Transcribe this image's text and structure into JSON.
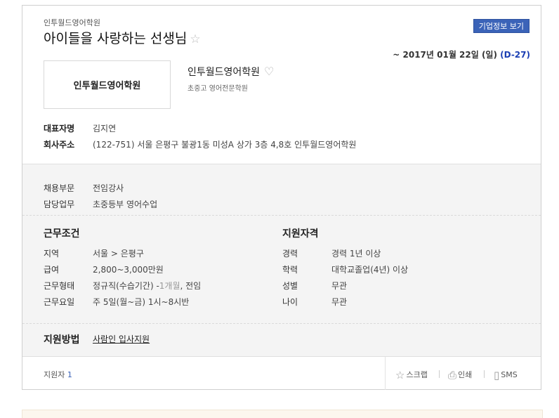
{
  "job": {
    "company_small": "인투월드영어학원",
    "title": "아이들을 사랑하는 선생님",
    "company_info_button": "기업정보 보기",
    "deadline_text": "~ 2017년 01월 22일 (일)",
    "dday": "(D-27)"
  },
  "company": {
    "logo_text": "인투월드영어학원",
    "name": "인투월드영어학원",
    "description": "초중고 영어전문학원",
    "ceo_label": "대표자명",
    "ceo": "김지연",
    "address_label": "회사주소",
    "address": "(122-751) 서울 은평구 불광1동 미성A 상가 3층 4,8호 인투월드영어학원"
  },
  "recruit": {
    "dept_label": "채용부문",
    "dept": "전임강사",
    "duty_label": "담당업무",
    "duty": "초중등부 영어수업"
  },
  "conditions": {
    "title": "근무조건",
    "region_label": "지역",
    "region": "서울 > 은평구",
    "salary_label": "급여",
    "salary": "2,800~3,000만원",
    "type_label": "근무형태",
    "type_main": "정규직(수습기간) -",
    "type_faded": "1개월",
    "type_tail": ", 전임",
    "days_label": "근무요일",
    "days": "주 5일(월~금) 1시~8시반"
  },
  "qualifications": {
    "title": "지원자격",
    "career_label": "경력",
    "career": "경력 1년 이상",
    "education_label": "학력",
    "education": "대학교졸업(4년) 이상",
    "gender_label": "성별",
    "gender": "무관",
    "age_label": "나이",
    "age": "무관"
  },
  "apply": {
    "label": "지원방법",
    "method": "사람인 입사지원"
  },
  "footer": {
    "applicants_label": "지원자",
    "applicants_count": "1",
    "scrap": "스크랩",
    "print": "인쇄",
    "sms": "SMS"
  },
  "colors": {
    "accent": "#3b63b8",
    "dday": "#1a3eb3"
  }
}
